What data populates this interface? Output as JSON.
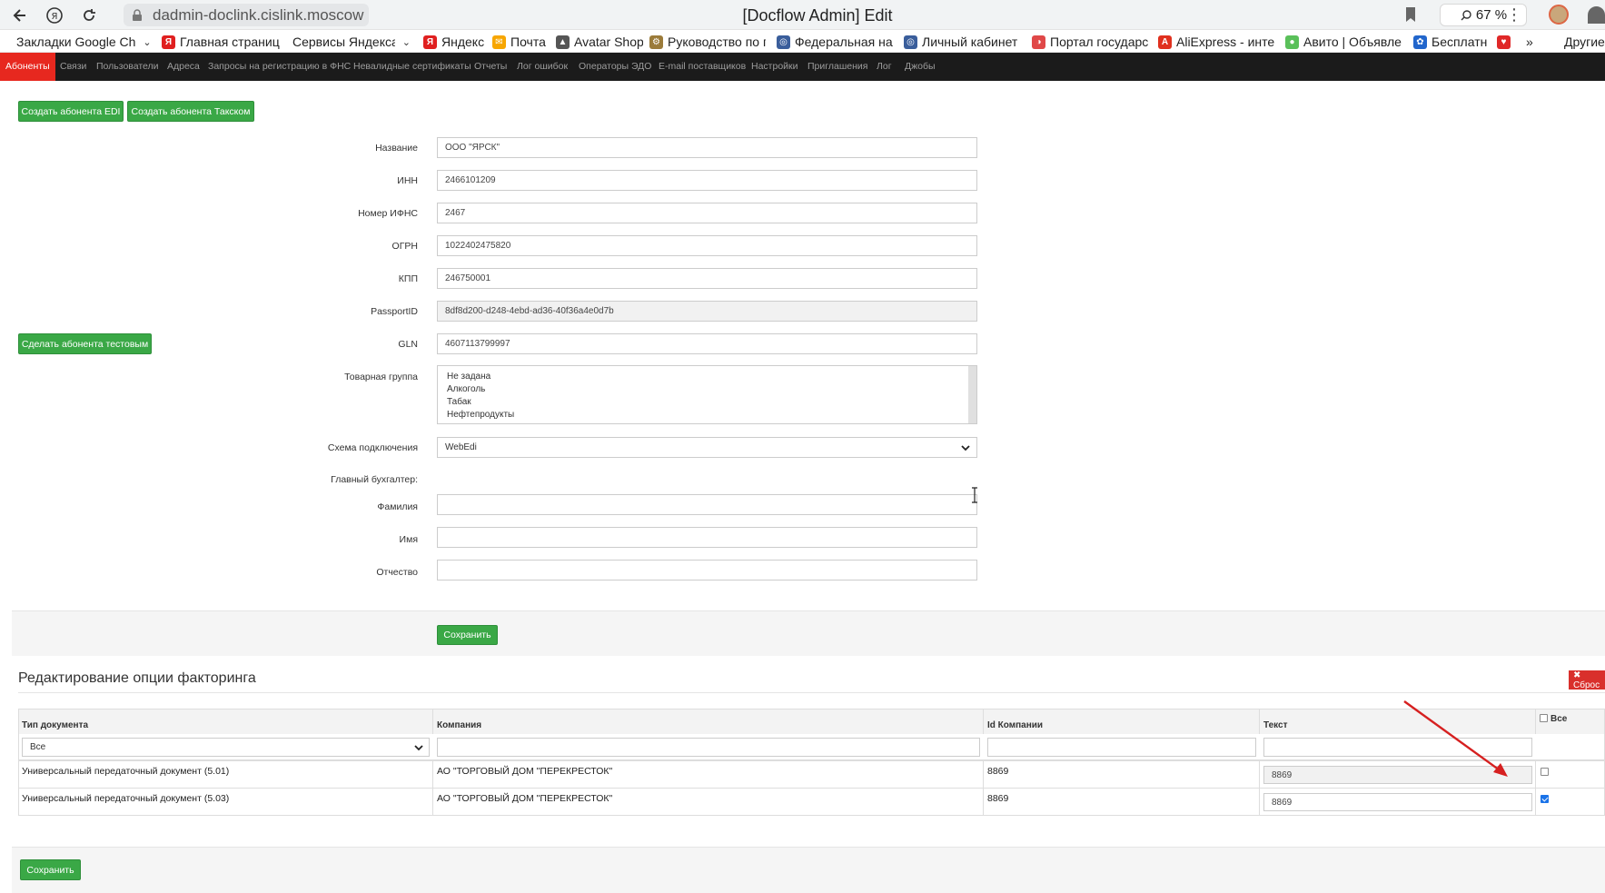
{
  "browser": {
    "url": "dadmin-doclink.cislink.moscow",
    "title": "[Docflow Admin] Edit",
    "zoom": "67 %",
    "icons": [
      "back-icon",
      "yandex-icon",
      "reload-icon",
      "lock-icon",
      "bookmark-icon",
      "zoom-icon",
      "kebab-menu-icon",
      "profile-avatar"
    ]
  },
  "bookmarks": [
    {
      "label": "Закладки Google Ch",
      "chevron": "⌄",
      "color": "#ffffff"
    },
    {
      "label": "Главная страница",
      "color": "#e02020",
      "glyph": "Я"
    },
    {
      "label": "Сервисы Яндекса",
      "chevron": "⌄",
      "color": "#ffffff"
    },
    {
      "label": "Яндекс",
      "color": "#e02020",
      "glyph": "Я"
    },
    {
      "label": "Почта",
      "color": "#f7a600",
      "glyph": "✉"
    },
    {
      "label": "Avatar Shop",
      "color": "#555555",
      "glyph": "▲"
    },
    {
      "label": "Руководство по п",
      "color": "#9b7b3a",
      "glyph": "⚙"
    },
    {
      "label": "Федеральная нал",
      "color": "#3a5e9b",
      "glyph": "◎"
    },
    {
      "label": "Личный кабинет",
      "color": "#3a5e9b",
      "glyph": "◎"
    },
    {
      "label": "Портал государс",
      "color": "#e04848",
      "glyph": "◑"
    },
    {
      "label": "AliExpress - интер",
      "color": "#e0301e",
      "glyph": "A"
    },
    {
      "label": "Авито | Объявлен",
      "color": "#5ac05a",
      "glyph": "●"
    },
    {
      "label": "Бесплатн",
      "color": "#2266cc",
      "glyph": "✿"
    },
    {
      "label": "",
      "color": "#e02828",
      "glyph": "♥"
    },
    {
      "label": "»",
      "color": "#ffffff"
    },
    {
      "label": "Другие",
      "color": "#ffffff"
    }
  ],
  "appnav": [
    {
      "label": "Абоненты",
      "active": true
    },
    {
      "label": "Связи"
    },
    {
      "label": "Пользователи"
    },
    {
      "label": "Адреса"
    },
    {
      "label": "Запросы на регистрацию в ФНС"
    },
    {
      "label": "Невалидные сертификаты"
    },
    {
      "label": "Отчеты"
    },
    {
      "label": "Лог ошибок"
    },
    {
      "label": "Операторы ЭДО"
    },
    {
      "label": "E-mail поставщиков"
    },
    {
      "label": "Настройки"
    },
    {
      "label": "Приглашения"
    },
    {
      "label": "Лог"
    },
    {
      "label": "Джобы"
    }
  ],
  "actions": {
    "create_edi": "Создать абонента EDI",
    "create_taxcom": "Создать абонента Такском",
    "make_test": "Сделать абонента тестовым"
  },
  "form": {
    "name_label": "Название",
    "name_value": "ООО \"ЯРСК\"",
    "inn_label": "ИНН",
    "inn_value": "2466101209",
    "ifns_label": "Номер ИФНС",
    "ifns_value": "2467",
    "ogrn_label": "ОГРН",
    "ogrn_value": "1022402475820",
    "kpp_label": "КПП",
    "kpp_value": "246750001",
    "passport_label": "PassportID",
    "passport_value": "8df8d200-d248-4ebd-ad36-40f36a4e0d7b",
    "gln_label": "GLN",
    "gln_value": "4607113799997",
    "group_label": "Товарная группа",
    "group_options": [
      "Не задана",
      "Алкоголь",
      "Табак",
      "Нефтепродукты"
    ],
    "scheme_label": "Схема подключения",
    "scheme_value": "WebEdi",
    "accountant_label": "Главный бухгалтер:",
    "surname_label": "Фамилия",
    "surname_value": "",
    "firstname_label": "Имя",
    "firstname_value": "",
    "patronymic_label": "Отчество",
    "patronymic_value": "",
    "save_label": "Сохранить"
  },
  "factoring": {
    "title": "Редактирование опции факторинга",
    "reset_label": "✖ Сброс",
    "columns": [
      "Тип документа",
      "Компания",
      "Id Компании",
      "Текст"
    ],
    "all_label": "Все",
    "filter_doc_type": "Все",
    "rows": [
      {
        "doc_type": "Универсальный передаточный документ (5.01)",
        "company": "АО \"ТОРГОВЫЙ ДОМ \"ПЕРЕКРЕСТОК\"",
        "company_id": "8869",
        "text": "8869",
        "checked": false
      },
      {
        "doc_type": "Универсальный передаточный документ (5.03)",
        "company": "АО \"ТОРГОВЫЙ ДОМ \"ПЕРЕКРЕСТОК\"",
        "company_id": "8869",
        "text": "8869",
        "checked": true
      }
    ],
    "save_label": "Сохранить"
  },
  "colors": {
    "accent_green": "#3aa846",
    "nav_active": "#e7281f",
    "annotation_arrow": "#d62020",
    "reset": "#d9302c"
  }
}
